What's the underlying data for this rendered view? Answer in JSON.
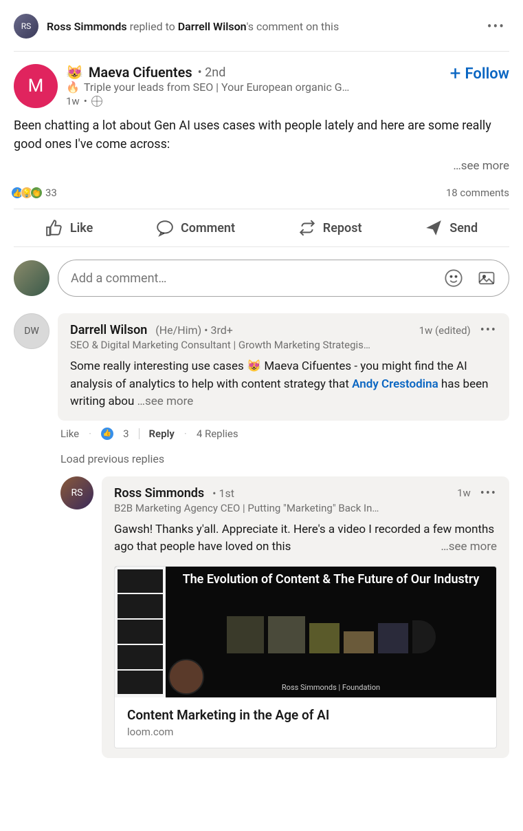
{
  "activity": {
    "actor": "Ross Simmonds",
    "verb": " replied to ",
    "target": "Darrell Wilson",
    "suffix": "'s comment on this"
  },
  "post": {
    "author_emoji": "😻",
    "author": "Maeva Cifuentes",
    "degree": "• 2nd",
    "headline_emoji": "🔥",
    "headline": "Triple your leads from SEO | Your European organic G…",
    "age": "1w",
    "body": "Been chatting a lot about Gen AI uses cases with people lately and here are some really good ones I've come across:",
    "see_more": "…see more",
    "reaction_count": "33",
    "comments_count": "18 comments"
  },
  "follow_label": "Follow",
  "actions": {
    "like": "Like",
    "comment": "Comment",
    "repost": "Repost",
    "send": "Send"
  },
  "compose": {
    "placeholder": "Add a comment…"
  },
  "comment1": {
    "name": "Darrell Wilson",
    "pronoun": "(He/Him)",
    "degree": "• 3rd+",
    "age": "1w (edited)",
    "headline": "SEO & Digital Marketing Consultant | Growth Marketing Strategis…",
    "text_pre": "Some really interesting use cases 😻 Maeva Cifuentes - you might find the AI analysis of analytics to help with content strategy that ",
    "link": "Andy Crestodina",
    "text_post": " has been writing abou   ",
    "see_more": "…see more",
    "like_label": "Like",
    "like_count": "3",
    "reply_label": "Reply",
    "replies_count": "4 Replies"
  },
  "load_prev": "Load previous replies",
  "reply1": {
    "name": "Ross Simmonds",
    "degree": "• 1st",
    "age": "1w",
    "headline": "B2B Marketing Agency CEO | Putting \"Marketing\" Back In…",
    "text": "Gawsh! Thanks y'all. Appreciate it. Here's a video I recorded a few months ago that people have loved on this",
    "see_more": "…see more",
    "preview": {
      "slide_title": "The Evolution of Content & The Future of Our Industry",
      "slide_footer": "Ross Simmonds | Foundation",
      "title": "Content Marketing in the Age of AI",
      "source": "loom.com"
    }
  }
}
